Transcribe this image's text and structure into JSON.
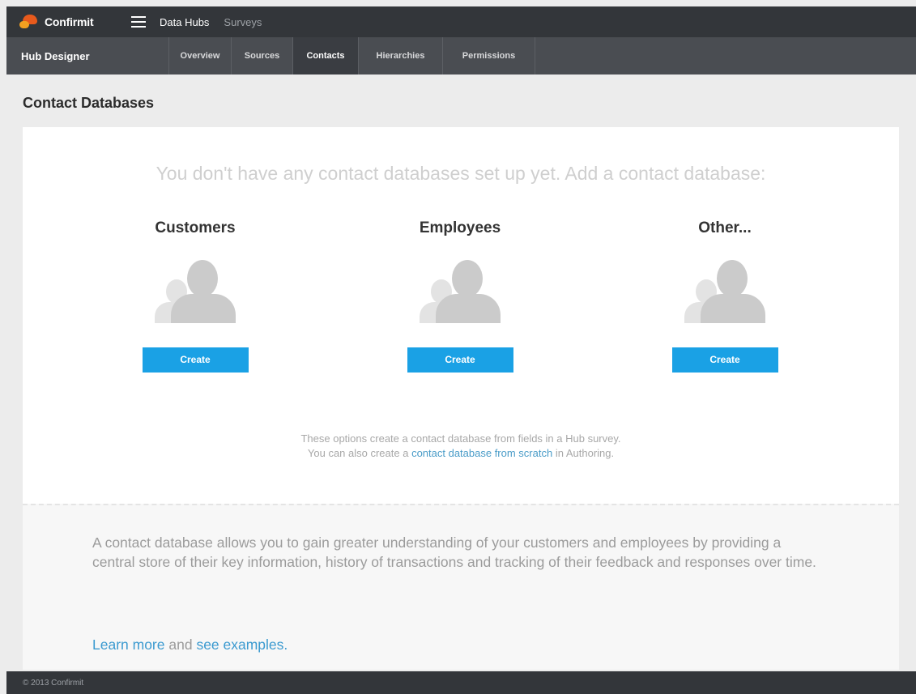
{
  "app": {
    "logo_text": "Confirmit",
    "nav_links": [
      {
        "label": "Data Hubs",
        "active": true
      },
      {
        "label": "Surveys",
        "active": false
      }
    ]
  },
  "subnav": {
    "title": "Hub Designer",
    "tabs": [
      {
        "label": "Overview",
        "active": false
      },
      {
        "label": "Sources",
        "active": false
      },
      {
        "label": "Contacts",
        "active": true
      },
      {
        "label": "Hierarchies",
        "active": false
      },
      {
        "label": "Permissions",
        "active": false
      }
    ]
  },
  "page": {
    "title": "Contact Databases",
    "headline": "You don't have any contact databases set up yet. Add a contact database:",
    "options": [
      {
        "title": "Customers",
        "button": "Create"
      },
      {
        "title": "Employees",
        "button": "Create"
      },
      {
        "title": "Other...",
        "button": "Create"
      }
    ],
    "note_line1": "These options create a contact database from fields in a Hub survey.",
    "note_line2_prefix": "You can also create a ",
    "note_line2_link": "contact database from scratch",
    "note_line2_suffix": " in Authoring.",
    "description": "A contact database allows you to gain greater understanding of your customers and employees by providing a central store of their key information, history of transactions and tracking of their feedback and responses over time.",
    "learn_more": "Learn more",
    "and_text": " and ",
    "see_examples": "see examples."
  },
  "footer": {
    "text": "© 2013 Confirmit"
  },
  "colors": {
    "topbar": "#33363a",
    "subbar": "#4a4d52",
    "button": "#1aa1e5",
    "link": "#3b9ad0"
  }
}
